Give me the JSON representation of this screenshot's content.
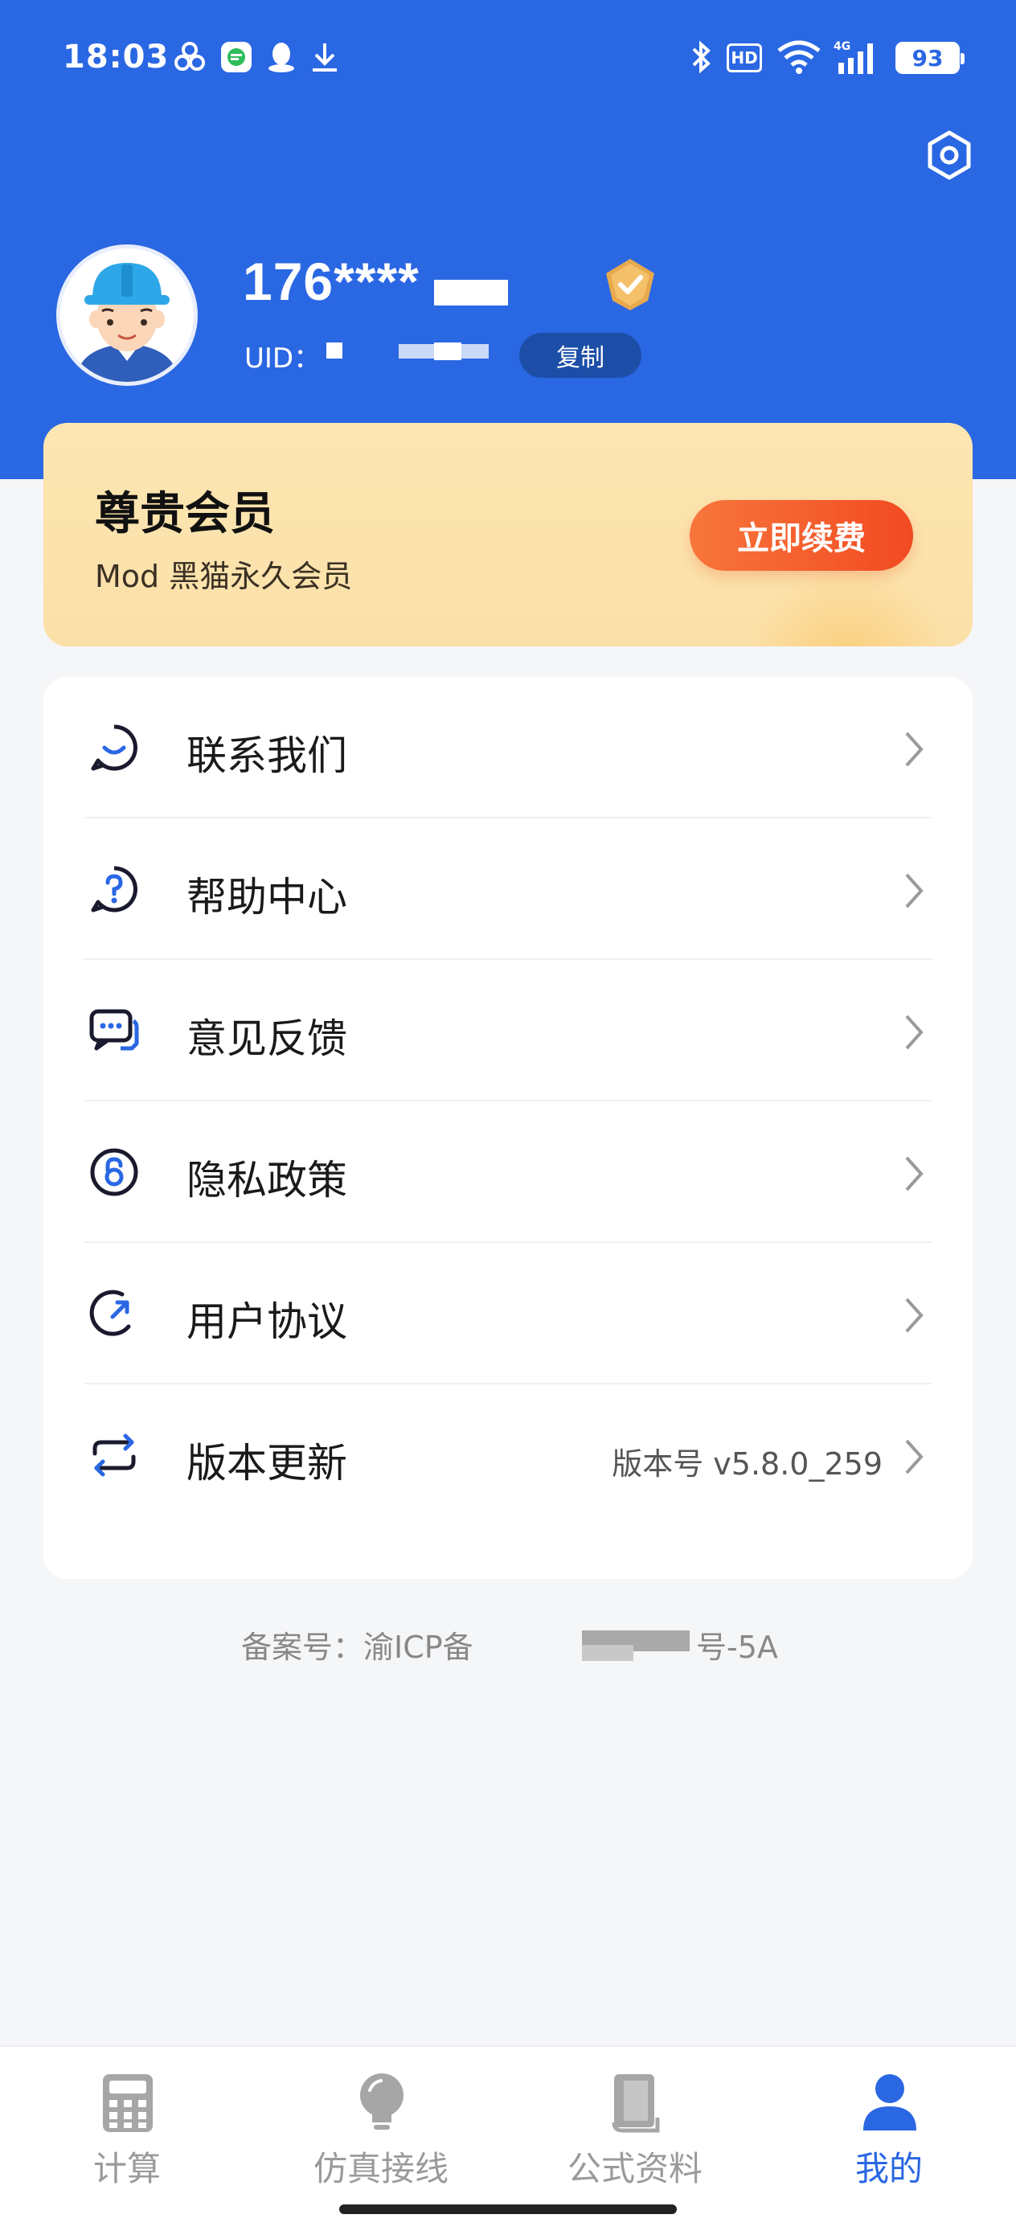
{
  "status_bar": {
    "time": "18:03",
    "battery": "93",
    "hd_label": "HD",
    "network_label": "4G",
    "icons": [
      "app-icon-cluster",
      "wechat-icon",
      "qq-icon",
      "download-icon",
      "bluetooth-icon",
      "wifi-icon",
      "signal-icon"
    ]
  },
  "profile": {
    "phone": "176****",
    "uid_label": "UID：",
    "copy_label": "复制",
    "badge_icon": "vip-diamond-icon",
    "settings_icon": "settings-gear-icon"
  },
  "membership": {
    "title": "尊贵会员",
    "subtitle": "Mod 黑猫永久会员",
    "renew_label": "立即续费"
  },
  "menu": {
    "items": [
      {
        "label": "联系我们",
        "icon": "contact-chat-icon",
        "value": ""
      },
      {
        "label": "帮助中心",
        "icon": "help-question-icon",
        "value": ""
      },
      {
        "label": "意见反馈",
        "icon": "feedback-icon",
        "value": ""
      },
      {
        "label": "隐私政策",
        "icon": "privacy-lock-icon",
        "value": ""
      },
      {
        "label": "用户协议",
        "icon": "user-agreement-icon",
        "value": ""
      },
      {
        "label": "版本更新",
        "icon": "update-icon",
        "value": "版本号 v5.8.0_259"
      }
    ]
  },
  "icp": {
    "prefix": "备案号：渝ICP备",
    "suffix": "号-5A"
  },
  "tabs": [
    {
      "label": "计算",
      "icon": "calculator-icon",
      "active": false
    },
    {
      "label": "仿真接线",
      "icon": "bulb-icon",
      "active": false
    },
    {
      "label": "公式资料",
      "icon": "book-icon",
      "active": false
    },
    {
      "label": "我的",
      "icon": "person-icon",
      "active": true
    }
  ],
  "colors": {
    "primary": "#2a67e3",
    "member_bg": "#fde6b2",
    "renew_button": "#f24a22",
    "inactive_tab": "#9a9a9a"
  }
}
